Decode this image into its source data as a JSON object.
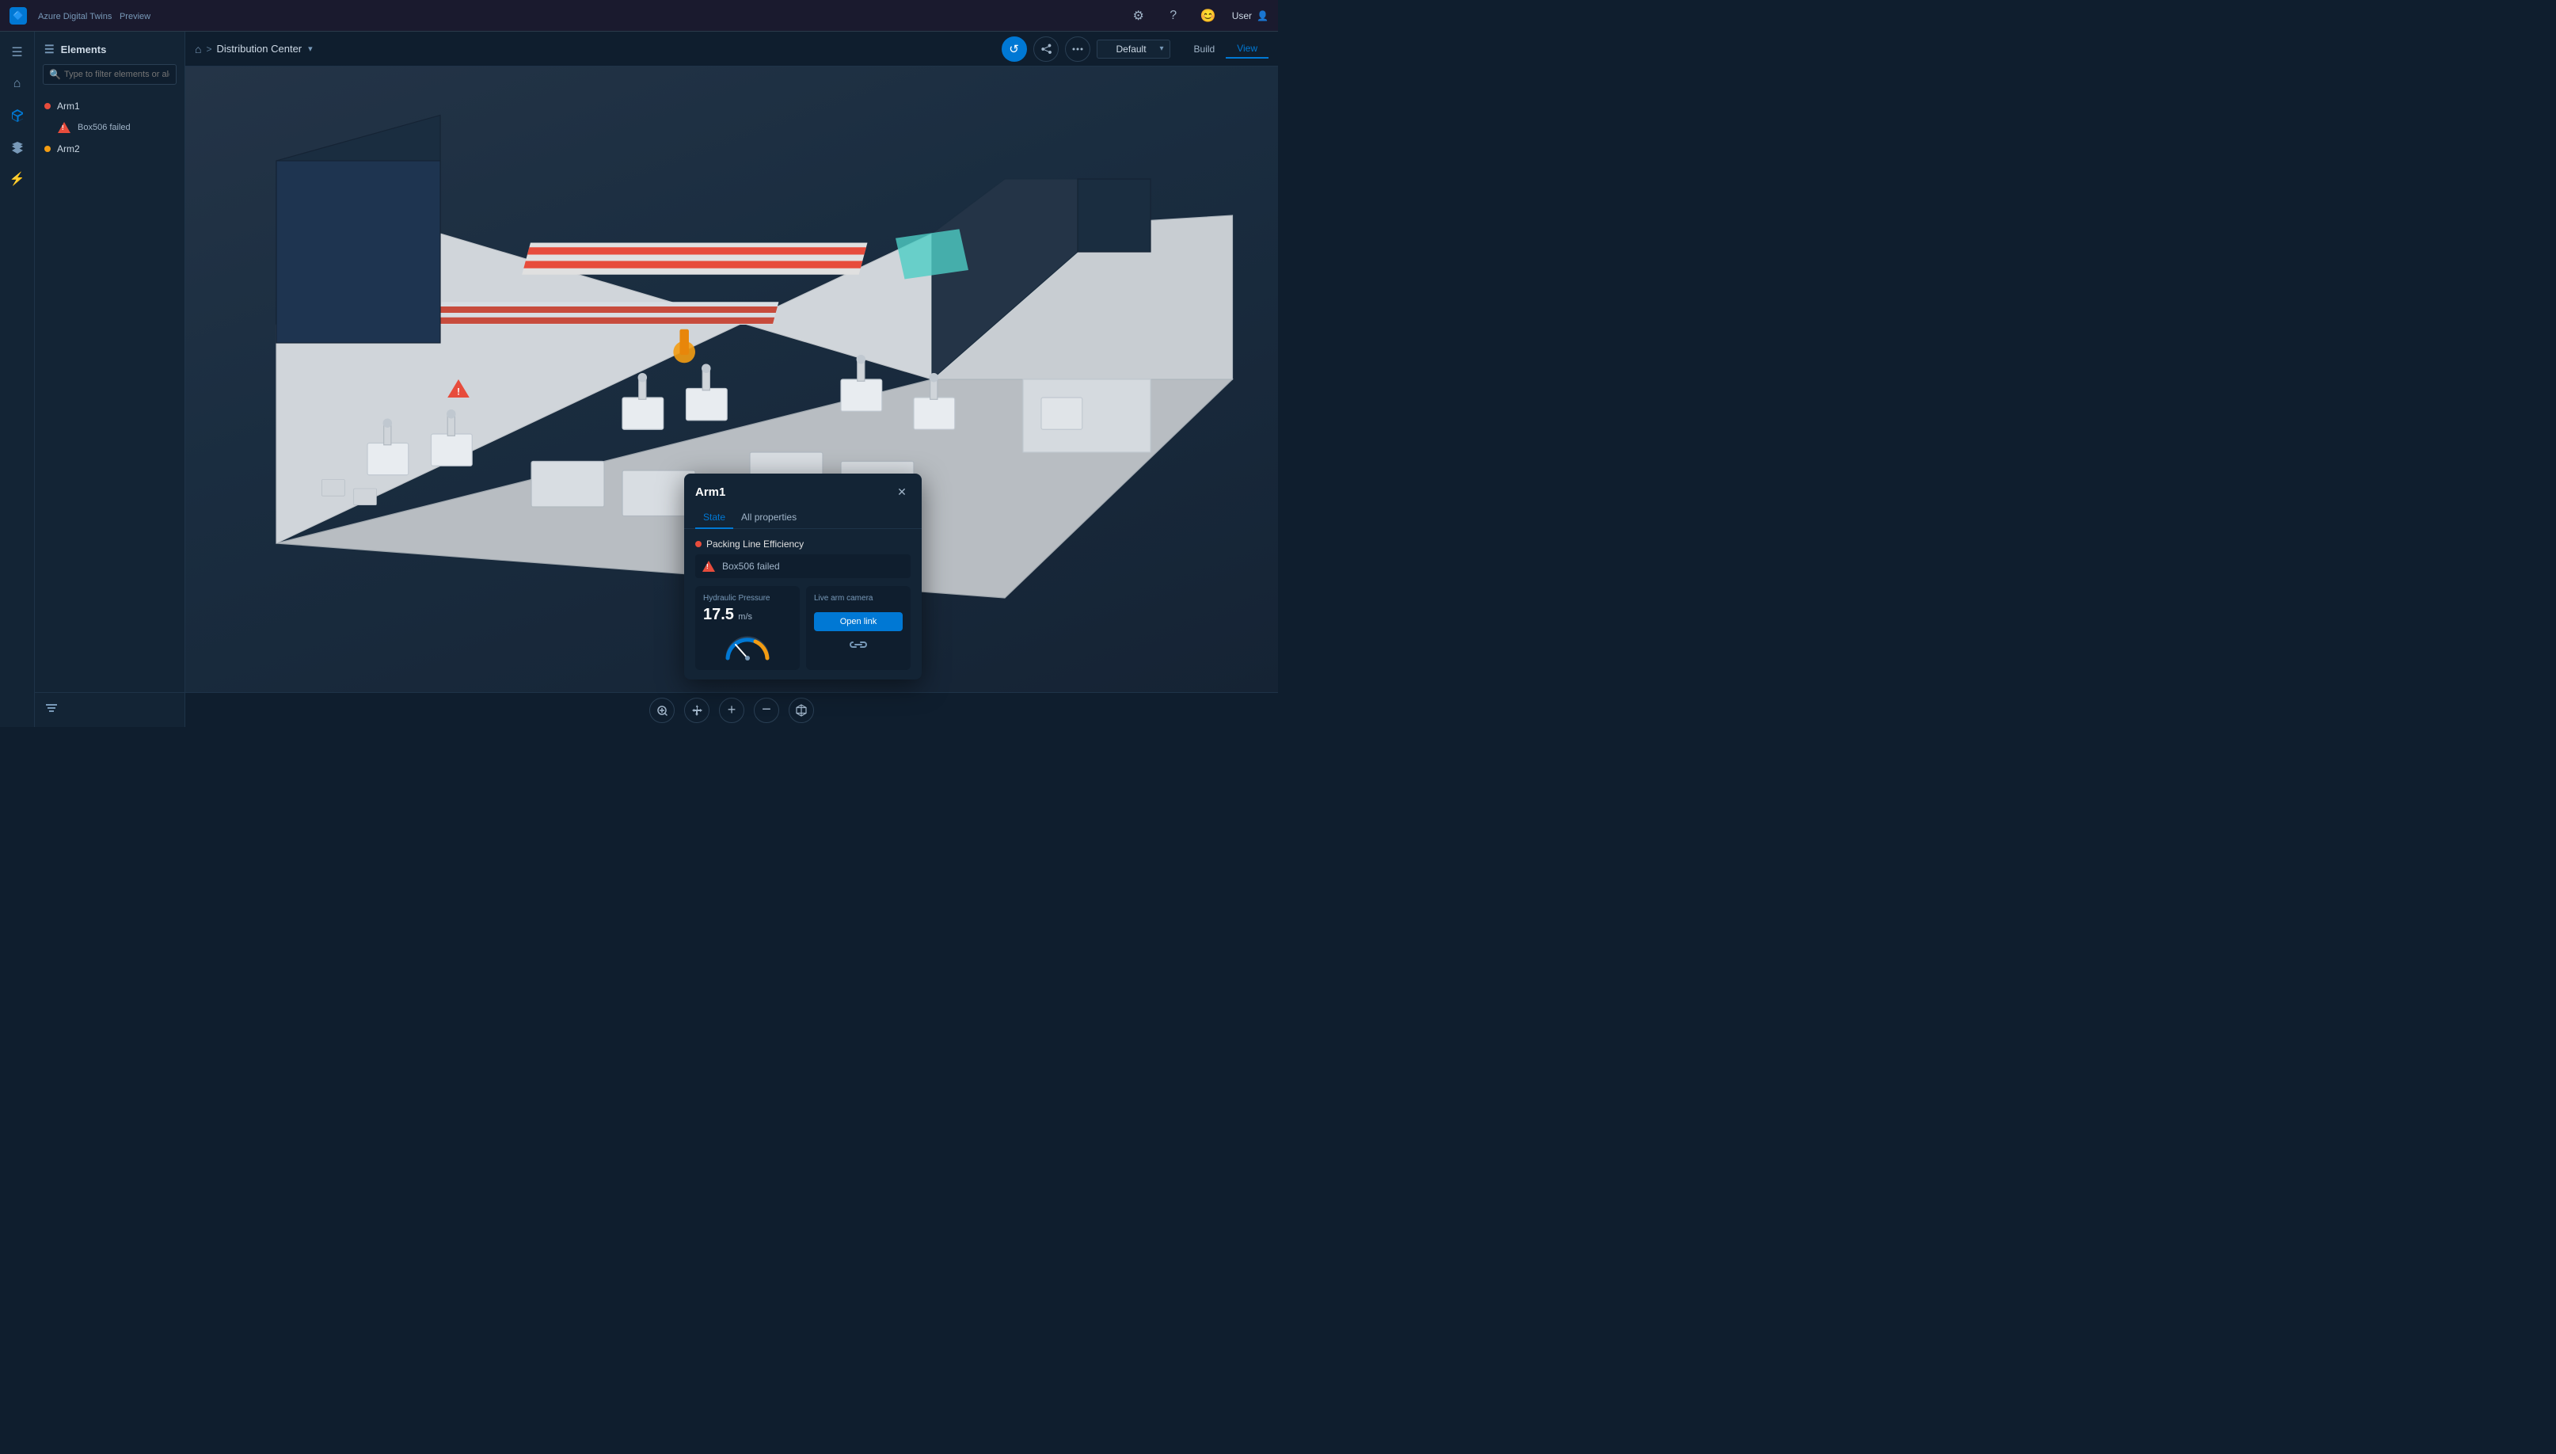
{
  "app": {
    "name": "Azure Digital Twins",
    "badge": "Preview",
    "icon": "🔷"
  },
  "topnav": {
    "settings_label": "⚙",
    "help_label": "?",
    "user_label": "😊",
    "user_name": "User",
    "user_icon": "👤"
  },
  "breadcrumb": {
    "home_icon": "🏠",
    "separator": ">",
    "page_name": "Distribution Center",
    "chevron": "▾"
  },
  "topbar": {
    "refresh_icon": "↺",
    "share_icon": "⬆",
    "settings_icon": "⚙",
    "env_label": "Default",
    "env_dropdown_icon": "▾",
    "build_label": "Build",
    "view_label": "View"
  },
  "sidebar": {
    "items": [
      {
        "id": "menu",
        "icon": "☰",
        "active": false
      },
      {
        "id": "home",
        "icon": "🏠",
        "active": false
      },
      {
        "id": "3d",
        "icon": "⬡",
        "active": true
      },
      {
        "id": "layers",
        "icon": "📋",
        "active": false
      },
      {
        "id": "lightning",
        "icon": "⚡",
        "active": false
      }
    ]
  },
  "elements_panel": {
    "title": "Elements",
    "search_placeholder": "Type to filter elements or alerts",
    "items": [
      {
        "id": "arm1",
        "label": "Arm1",
        "status": "red",
        "children": [
          {
            "id": "box506",
            "label": "Box506 failed",
            "type": "alert"
          }
        ]
      },
      {
        "id": "arm2",
        "label": "Arm2",
        "status": "orange",
        "children": []
      }
    ],
    "filter_icon": "≡"
  },
  "popup": {
    "title": "Arm1",
    "close_icon": "✕",
    "tabs": [
      {
        "id": "state",
        "label": "State",
        "active": true
      },
      {
        "id": "properties",
        "label": "All properties",
        "active": false
      }
    ],
    "section_title": "Packing Line Efficiency",
    "alert_text": "Box506 failed",
    "hydraulic_card": {
      "label": "Hydraulic Pressure",
      "value": "17.5",
      "unit": "m/s"
    },
    "camera_card": {
      "label": "Live arm camera",
      "open_link_label": "Open link",
      "link_icon": "🔗"
    }
  },
  "bottom_toolbar": {
    "zoom_fit": "⊕",
    "move": "✥",
    "zoom_in": "+",
    "zoom_out": "−",
    "cube": "◻"
  },
  "colors": {
    "accent": "#0078d4",
    "bg_dark": "#0f1e2e",
    "bg_panel": "#132435",
    "bg_mid": "#1a2d40",
    "border": "#1e3348",
    "text_primary": "#cdd9e5",
    "text_secondary": "#7899b8",
    "red": "#e74c3c",
    "orange": "#f39c12"
  }
}
